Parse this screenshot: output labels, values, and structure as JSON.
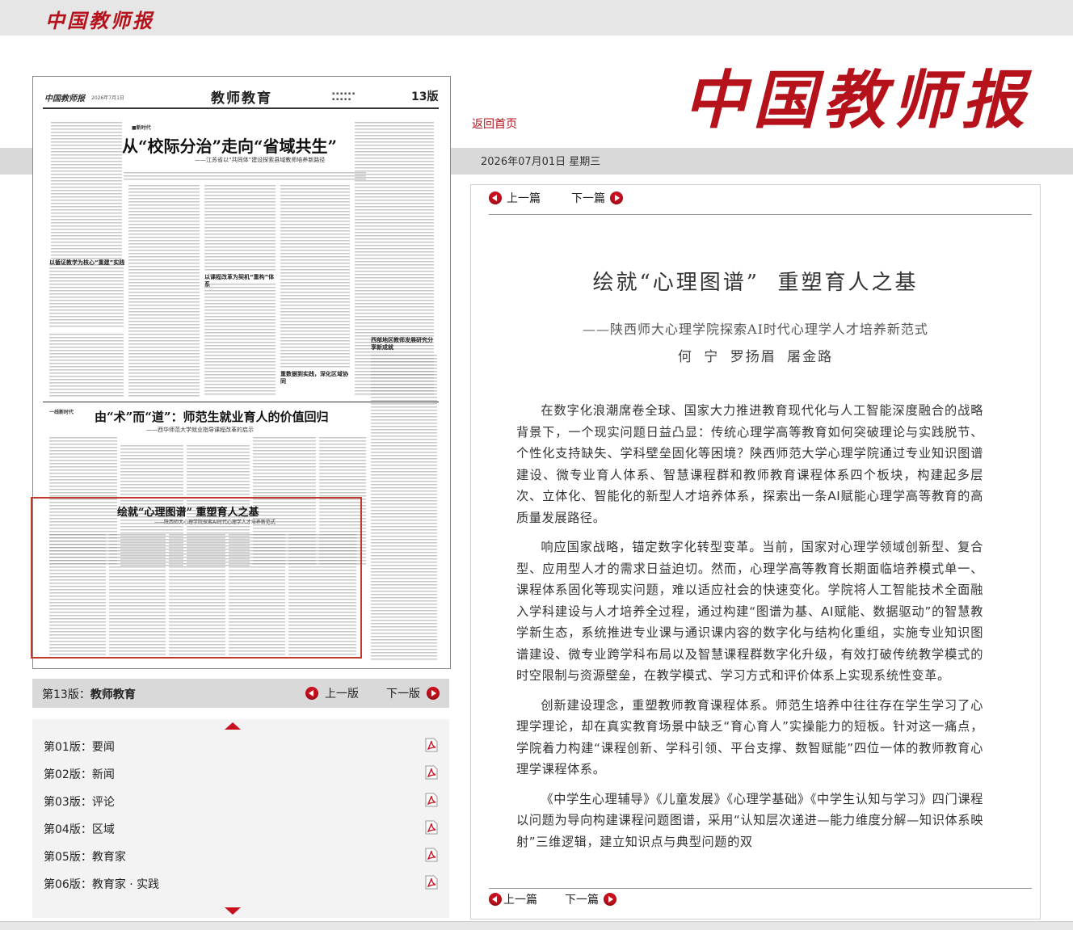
{
  "site": {
    "logo_text": "中国教师报",
    "home_link": "返回首页",
    "date": "2026年07月01日  星期三"
  },
  "paper": {
    "masthead": "中国教师报",
    "masthead_date": "2026年7月1日",
    "section_title": "教师教育",
    "page_num": "13版",
    "headline1": "从“校际分治”走向“省域共生”",
    "headline1_sub": "——江苏省以“共同体”建设探索县域教师培养新路径",
    "headline2": "由“术”而“道”：师范生就业育人的价值回归",
    "headline2_sub": "——西华师范大学就业指导课程改革的启示",
    "headline3": "绘就“心理图谱”  重塑育人之基",
    "headline3_sub": "——陕西师大心理学院探索AI时代心理学人才培养新范式",
    "side_title": "西部地区教师发展研究分享新成就",
    "tag1": "■新时代",
    "tag2": "一线新时代",
    "sub_head_a": "以循证教学为核心“重建”实践",
    "sub_head_b": "以课程改革为契机“重构”体系",
    "sub_head_c": "重数据到实践，深化区域协同"
  },
  "pager": {
    "edition_prefix": "第13版：",
    "edition_name": "教师教育",
    "prev": "上一版",
    "next": "下一版"
  },
  "editions": [
    {
      "label": "第01版：要闻"
    },
    {
      "label": "第02版：新闻"
    },
    {
      "label": "第03版：评论"
    },
    {
      "label": "第04版：区域"
    },
    {
      "label": "第05版：教育家"
    },
    {
      "label": "第06版：教育家 · 实践"
    }
  ],
  "article": {
    "prev": "上一篇",
    "next": "下一篇",
    "title": "绘就“心理图谱”  重塑育人之基",
    "subtitle": "——陕西师大心理学院探索AI时代心理学人才培养新范式",
    "authors": "何 宁 罗扬眉 屠金路",
    "paragraphs": [
      "在数字化浪潮席卷全球、国家大力推进教育现代化与人工智能深度融合的战略背景下，一个现实问题日益凸显：传统心理学高等教育如何突破理论与实践脱节、个性化支持缺失、学科壁垒固化等困境？陕西师范大学心理学院通过专业知识图谱建设、微专业育人体系、智慧课程群和教师教育课程体系四个板块，构建起多层次、立体化、智能化的新型人才培养体系，探索出一条AI赋能心理学高等教育的高质量发展路径。",
      "响应国家战略，锚定数字化转型变革。当前，国家对心理学领域创新型、复合型、应用型人才的需求日益迫切。然而，心理学高等教育长期面临培养模式单一、课程体系固化等现实问题，难以适应社会的快速变化。学院将人工智能技术全面融入学科建设与人才培养全过程，通过构建“图谱为基、AI赋能、数据驱动”的智慧教学新生态，系统推进专业课与通识课内容的数字化与结构化重组，实施专业知识图谱建设、微专业跨学科布局以及智慧课程群数字化升级，有效打破传统教学模式的时空限制与资源壁垒，在教学模式、学习方式和评价体系上实现系统性变革。",
      "创新建设理念，重塑教师教育课程体系。师范生培养中往往存在学生学习了心理学理论，却在真实教育场景中缺乏“育心育人”实操能力的短板。针对这一痛点，学院着力构建“课程创新、学科引领、平台支撑、数智赋能”四位一体的教师教育心理学课程体系。",
      "《中学生心理辅导》《儿童发展》《心理学基础》《中学生认知与学习》四门课程以问题为导向构建课程问题图谱，采用“认知层次递进—能力维度分解—知识体系映射”三维逻辑，建立知识点与典型问题的双"
    ]
  }
}
